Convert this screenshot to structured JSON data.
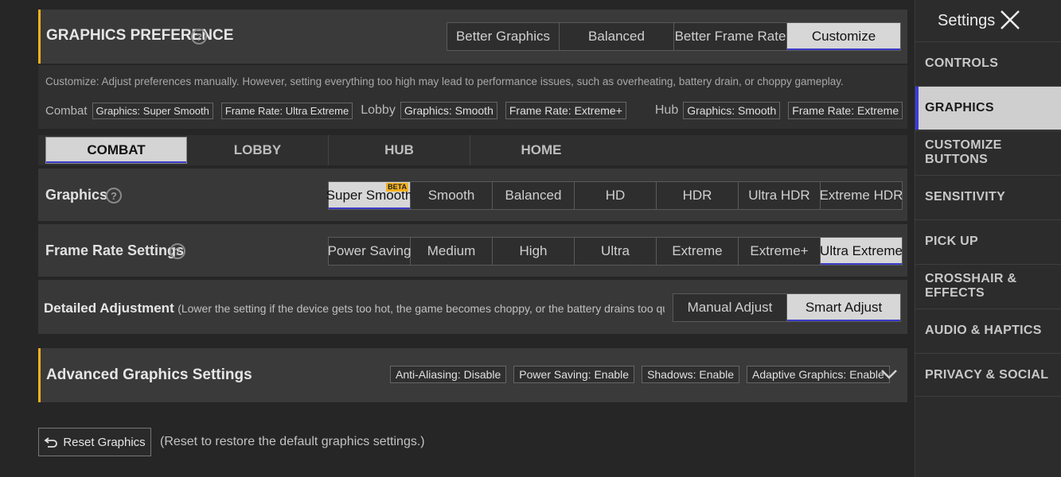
{
  "graphics_preference": {
    "title": "GRAPHICS PREFERENCE",
    "help_icon": "?",
    "options": [
      "Better Graphics",
      "Balanced",
      "Better Frame Rate",
      "Customize"
    ],
    "selected": "Customize"
  },
  "customize_note": "Customize: Adjust preferences manually. However, setting everything too high may lead to performance issues, such as overheating, battery drain, or choppy gameplay.",
  "summary": {
    "combat_label": "Combat",
    "combat_graphics": "Graphics: Super Smooth",
    "combat_frame": "Frame Rate: Ultra Extreme",
    "lobby_label": "Lobby",
    "lobby_graphics": "Graphics: Smooth",
    "lobby_frame": "Frame Rate: Extreme+",
    "hub_label": "Hub",
    "hub_graphics": "Graphics: Smooth",
    "hub_frame": "Frame Rate: Extreme"
  },
  "mode_tabs": [
    "COMBAT",
    "LOBBY",
    "HUB",
    "HOME"
  ],
  "mode_selected": "COMBAT",
  "graphics": {
    "label": "Graphics",
    "options": [
      "Super Smooth",
      "Smooth",
      "Balanced",
      "HD",
      "HDR",
      "Ultra HDR",
      "Extreme HDR"
    ],
    "selected": "Super Smooth",
    "beta_badge": "BETA"
  },
  "frame_rate": {
    "label": "Frame Rate Settings",
    "options": [
      "Power Saving",
      "Medium",
      "High",
      "Ultra",
      "Extreme",
      "Extreme+",
      "Ultra Extreme"
    ],
    "selected": "Ultra Extreme"
  },
  "detailed_adjustment": {
    "label": "Detailed Adjustment",
    "note": "(Lower the setting if the device gets too hot, the game becomes choppy, or the battery drains too quickl",
    "options": [
      "Manual Adjust",
      "Smart Adjust"
    ],
    "selected": "Smart Adjust"
  },
  "advanced": {
    "title": "Advanced Graphics Settings",
    "chips": [
      "Anti-Aliasing: Disable",
      "Power Saving: Enable",
      "Shadows: Enable",
      "Adaptive Graphics: Enable"
    ],
    "expand_icon": "chevron-down-icon"
  },
  "reset": {
    "button_label": "Reset Graphics",
    "note": "(Reset to restore the default graphics settings.)"
  },
  "sidebar": {
    "title": "Settings",
    "items": [
      "CONTROLS",
      "GRAPHICS",
      "CUSTOMIZE BUTTONS",
      "SENSITIVITY",
      "PICK UP",
      "CROSSHAIR & EFFECTS",
      "AUDIO & HAPTICS",
      "PRIVACY & SOCIAL"
    ],
    "active": "GRAPHICS"
  },
  "colors": {
    "accent": "#f2b01e",
    "selected_bg": "#d7d7d7",
    "selected_underline": "#3a3ac8"
  }
}
